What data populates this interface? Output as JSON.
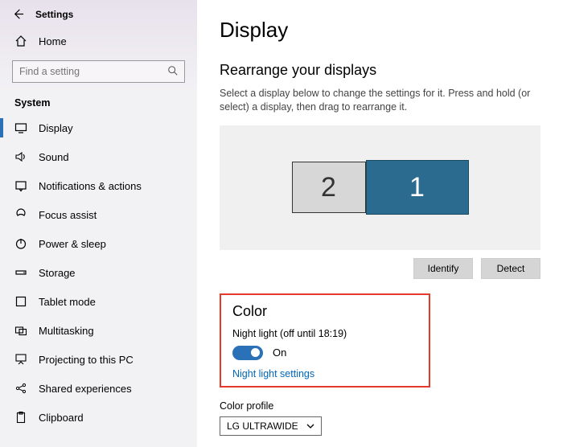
{
  "sidebar": {
    "title": "Settings",
    "home": "Home",
    "search_placeholder": "Find a setting",
    "section": "System",
    "items": [
      {
        "label": "Display"
      },
      {
        "label": "Sound"
      },
      {
        "label": "Notifications & actions"
      },
      {
        "label": "Focus assist"
      },
      {
        "label": "Power & sleep"
      },
      {
        "label": "Storage"
      },
      {
        "label": "Tablet mode"
      },
      {
        "label": "Multitasking"
      },
      {
        "label": "Projecting to this PC"
      },
      {
        "label": "Shared experiences"
      },
      {
        "label": "Clipboard"
      }
    ]
  },
  "main": {
    "title": "Display",
    "rearrange": {
      "title": "Rearrange your displays",
      "desc": "Select a display below to change the settings for it. Press and hold (or select) a display, then drag to rearrange it.",
      "monitors": {
        "primary": "1",
        "secondary": "2"
      },
      "identify": "Identify",
      "detect": "Detect"
    },
    "color": {
      "title": "Color",
      "night_light_label": "Night light (off until 18:19)",
      "toggle_state": "On",
      "night_light_settings": "Night light settings",
      "profile_label": "Color profile",
      "profile_value": "LG ULTRAWIDE"
    }
  }
}
